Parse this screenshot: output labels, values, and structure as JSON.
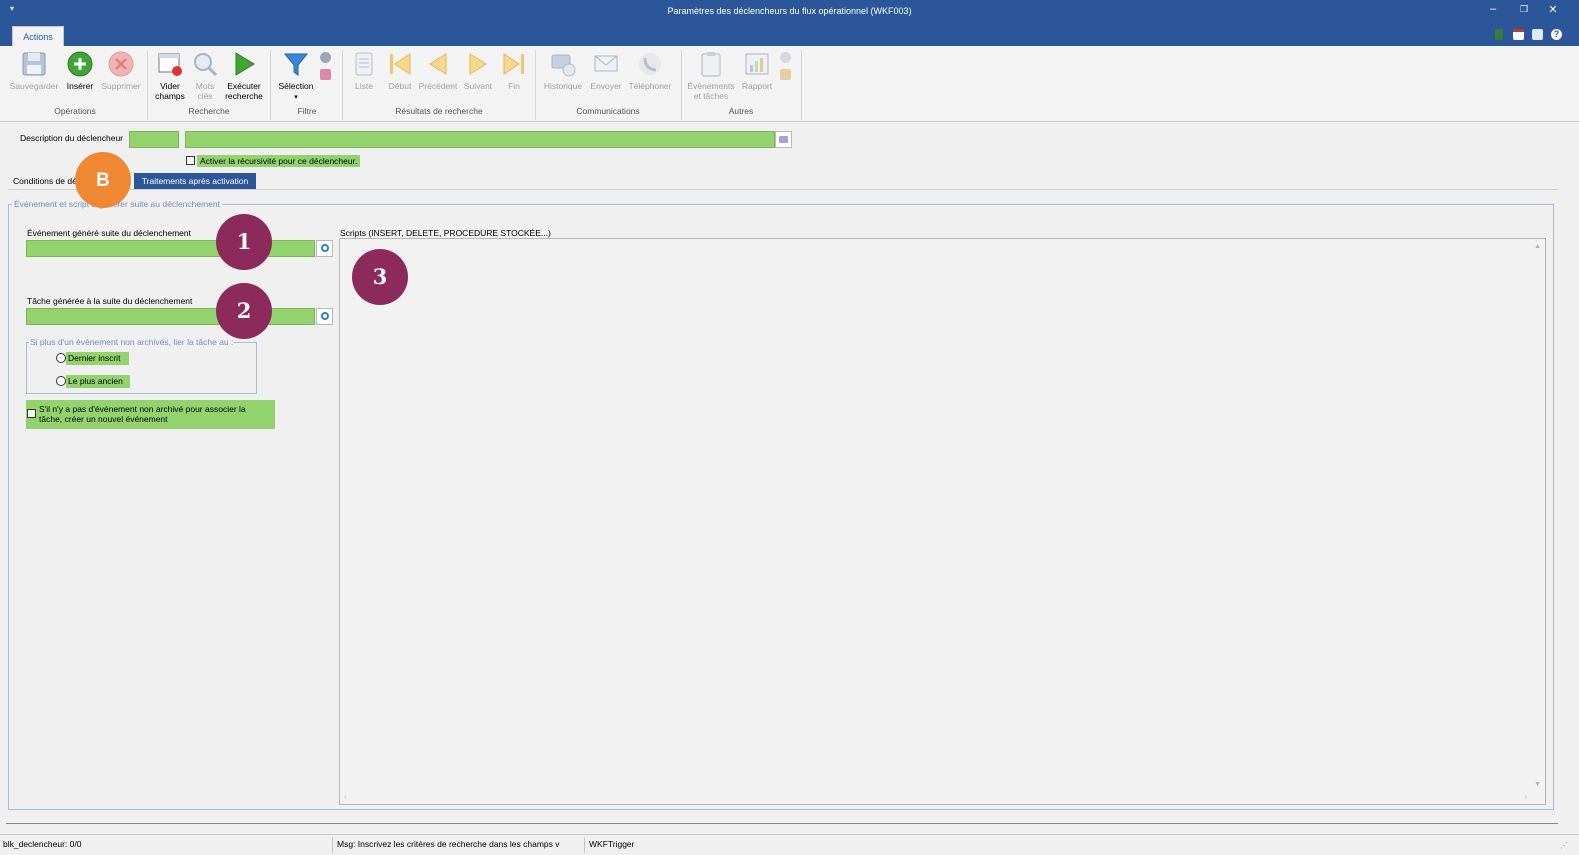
{
  "window": {
    "title": "Paramètres des déclencheurs du flux opérationnel (WKF003)",
    "qat_icon": "quick-access-icon",
    "minimize": "–",
    "restore": "❐",
    "close": "✕"
  },
  "ribbon": {
    "active_tab": "Actions",
    "groups": {
      "operations": "Opérations",
      "recherche": "Recherche",
      "filtre": "Filtre",
      "resultats": "Résultats de recherche",
      "communications": "Communications",
      "autres": "Autres"
    },
    "buttons": {
      "sauvegarder": "Sauvegarder",
      "inserer": "Insérer",
      "supprimer": "Supprimer",
      "vider_1": "Vider",
      "vider_2": "champs",
      "mots_1": "Mots",
      "mots_2": "clés",
      "executer_1": "Exécuter",
      "executer_2": "recherche",
      "selection": "Sélection",
      "liste": "Liste",
      "debut": "Début",
      "precedent": "Précédent",
      "suivant": "Suivant",
      "fin": "Fin",
      "historique": "Historique",
      "envoyer": "Envoyer",
      "telephoner": "Téléphoner",
      "evenements_1": "Événements",
      "evenements_2": "et tâches",
      "rapport": "Rapport"
    }
  },
  "form": {
    "description_label": "Description du déclencheur",
    "recursivity_label": "Activer la récursivité pour ce déclencheur.",
    "tab_conditions": "Conditions de dé",
    "tab_traitements": "Traitements après activation",
    "groupbox_title": "Événement et script à générer suite au déclenchement",
    "event_label": "Événement généré suite du déclenchement",
    "task_label": "Tâche générée à la suite du déclenchement",
    "link_group_title": "Si plus d'un événement non archivés, lier la tâche au :",
    "radio_last": "Dernier inscrit",
    "radio_oldest": "Le plus ancien",
    "create_event_line1": "S'il n'y a pas d'événement non archivé pour associer la",
    "create_event_line2": "tâche, créer un nouvel événement",
    "scripts_label": "Scripts (INSERT, DELETE, PROCEDURE STOCKÉE...)"
  },
  "badges": {
    "b": "B",
    "one": "1",
    "two": "2",
    "three": "3"
  },
  "status": {
    "block": "blk_declencheur: 0/0",
    "message": "Msg: Inscrivez les critères de recherche dans les champs v",
    "form": "WKFTrigger"
  },
  "colors": {
    "titlebar": "#2b579a",
    "field_green": "#92d36e",
    "badge_purple": "#8b2a5b",
    "badge_orange": "#f08833",
    "active_tab": "#2b579a"
  }
}
